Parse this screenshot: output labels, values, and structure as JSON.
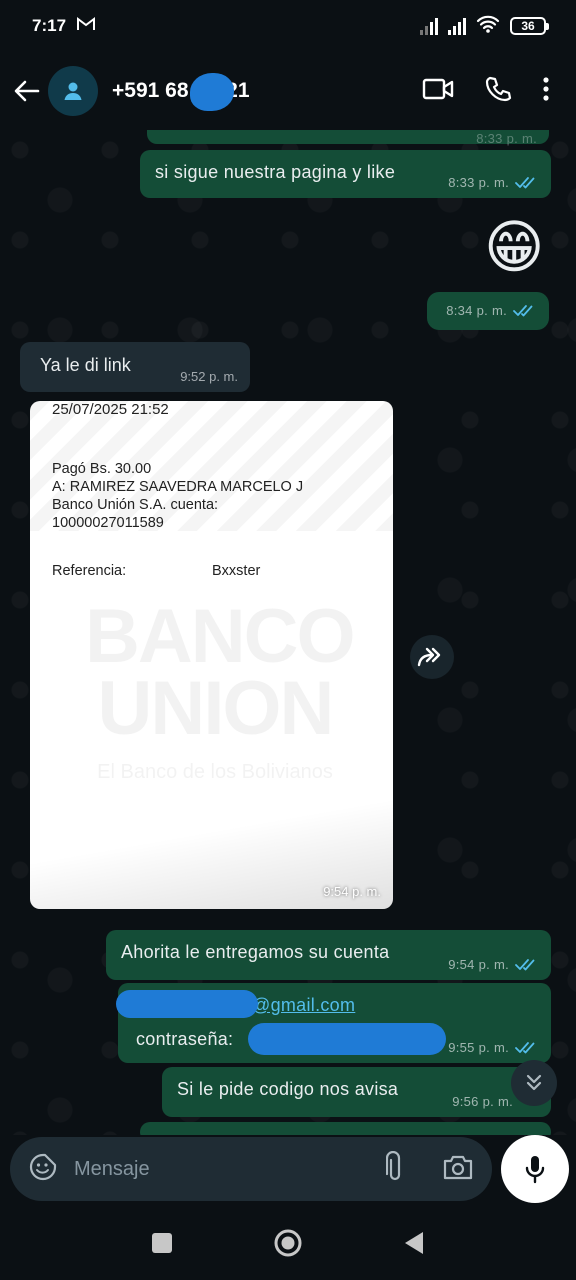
{
  "status": {
    "time": "7:17",
    "battery": "36"
  },
  "header": {
    "contact_prefix": "+591 68",
    "contact_suffix": "121"
  },
  "messages": [
    {
      "id": "m0",
      "text": "",
      "time": "8:33 p. m."
    },
    {
      "id": "m1",
      "text": "si sigue nuestra pagina y like",
      "time": "8:33 p. m."
    },
    {
      "id": "m2",
      "emoji": "😁",
      "time": "8:34 p. m."
    },
    {
      "id": "m3",
      "text": "Ya le di link",
      "time": "9:52 p. m."
    },
    {
      "id": "m4",
      "time": "9:54 p. m."
    },
    {
      "id": "m5",
      "text": "Ahorita le entregamos su cuenta",
      "time": "9:54 p. m."
    },
    {
      "id": "m6",
      "email_suffix": "@gmail.com",
      "password_label": "contraseña:",
      "time": "9:55 p. m."
    },
    {
      "id": "m7",
      "text": "Si le pide codigo nos avisa",
      "time": "9:56 p. m."
    }
  ],
  "receipt": {
    "datetime": "25/07/2025 21:52",
    "paid": "Pagó Bs. 30.00",
    "to": "A: RAMIREZ SAAVEDRA MARCELO J",
    "bank": "Banco Unión S.A. cuenta:",
    "account": "10000027011589",
    "reference_label": "Referencia:",
    "reference_value": "Bxxster",
    "watermark_line1": "BANCO",
    "watermark_line2": "UNION",
    "watermark_line3": "El Banco de los Bolivianos"
  },
  "input": {
    "placeholder": "Mensaje"
  },
  "colors": {
    "outgoing": "#144d37",
    "incoming": "#1f2c34",
    "accent": "#53bdeb"
  }
}
